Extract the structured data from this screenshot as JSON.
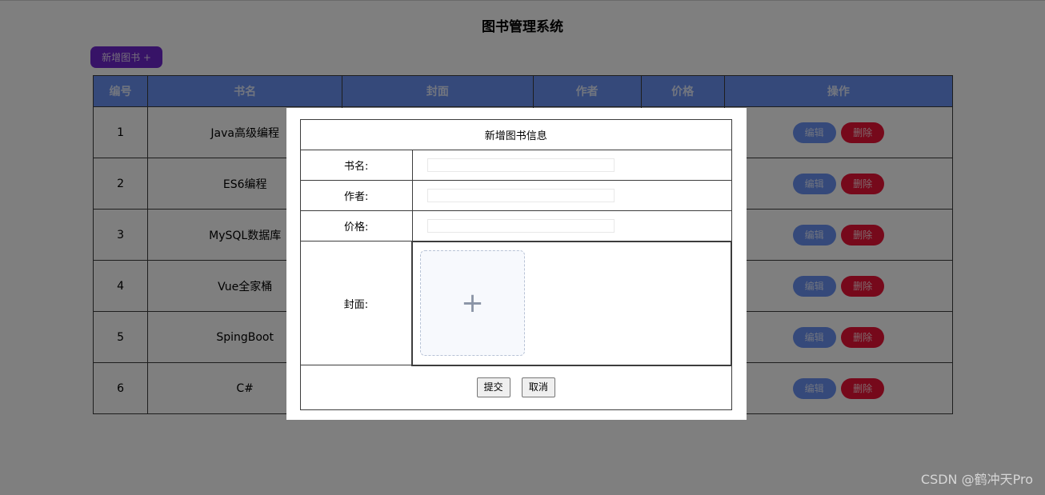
{
  "page": {
    "title": "图书管理系统",
    "add_button_label": "新增图书 +"
  },
  "table": {
    "headers": [
      "编号",
      "书名",
      "封面",
      "作者",
      "价格",
      "操作"
    ],
    "rows": [
      {
        "id": "1",
        "name": "Java高级编程"
      },
      {
        "id": "2",
        "name": "ES6编程"
      },
      {
        "id": "3",
        "name": "MySQL数据库"
      },
      {
        "id": "4",
        "name": "Vue全家桶"
      },
      {
        "id": "5",
        "name": "SpingBoot"
      },
      {
        "id": "6",
        "name": "C#"
      }
    ],
    "edit_label": "编辑",
    "delete_label": "删除"
  },
  "modal": {
    "title": "新增图书信息",
    "name_label": "书名:",
    "author_label": "作者:",
    "price_label": "价格:",
    "cover_label": "封面:",
    "name_value": "",
    "author_value": "",
    "price_value": "",
    "upload_icon": "plus-icon",
    "submit_label": "提交",
    "cancel_label": "取消"
  },
  "watermark": "CSDN @鹤冲天Pro",
  "colors": {
    "header_bg": "#6b92f5",
    "add_button": "#6f26cf",
    "edit_button": "#6b92f5",
    "delete_button": "#ec1236",
    "overlay": "rgba(0,0,0,0.5)"
  }
}
